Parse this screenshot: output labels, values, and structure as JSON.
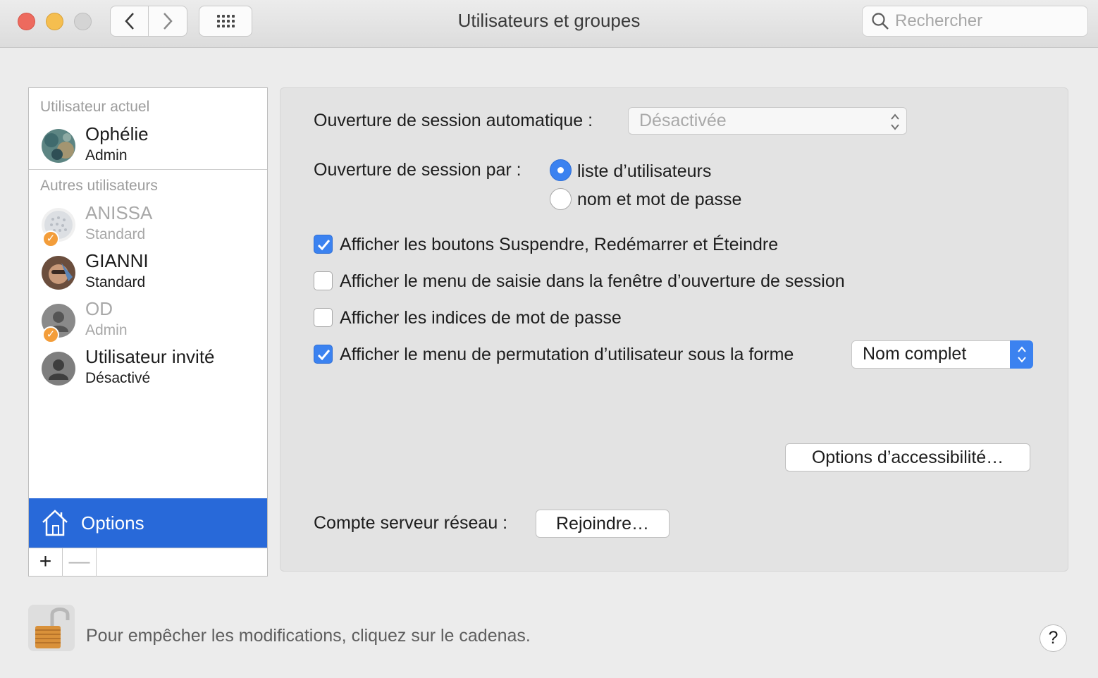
{
  "window": {
    "title": "Utilisateurs et groupes"
  },
  "search": {
    "placeholder": "Rechercher"
  },
  "sidebar": {
    "current_label": "Utilisateur actuel",
    "current_user": {
      "name": "Ophélie",
      "role": "Admin"
    },
    "others_label": "Autres utilisateurs",
    "others": [
      {
        "name": "ANISSA",
        "role": "Standard"
      },
      {
        "name": "GIANNI",
        "role": "Standard"
      },
      {
        "name": "OD",
        "role": "Admin"
      },
      {
        "name": "Utilisateur invité",
        "role": "Désactivé"
      }
    ],
    "options_label": "Options",
    "add_symbol": "+",
    "remove_symbol": "—"
  },
  "panel": {
    "auto_login_label": "Ouverture de session automatique :",
    "auto_login_value": "Désactivée",
    "login_by_label": "Ouverture de session par :",
    "radio_list_label": "liste d’utilisateurs",
    "radio_name_label": "nom et mot de passe",
    "checkbox_1": "Afficher les boutons Suspendre, Redémarrer et Éteindre",
    "checkbox_2": "Afficher le menu de saisie dans la fenêtre d’ouverture de session",
    "checkbox_3": "Afficher les indices de mot de passe",
    "checkbox_4": "Afficher le menu de permutation d’utilisateur sous la forme",
    "switch_menu_value": "Nom complet",
    "accessibility_button": "Options d’accessibilité…",
    "network_label": "Compte serveur réseau :",
    "join_button": "Rejoindre…"
  },
  "footer": {
    "lock_text": "Pour empêcher les modifications, cliquez sur le cadenas.",
    "help": "?"
  },
  "colors": {
    "accent": "#3b82f0",
    "selection": "#2869d9",
    "badge": "#f39d3a"
  }
}
